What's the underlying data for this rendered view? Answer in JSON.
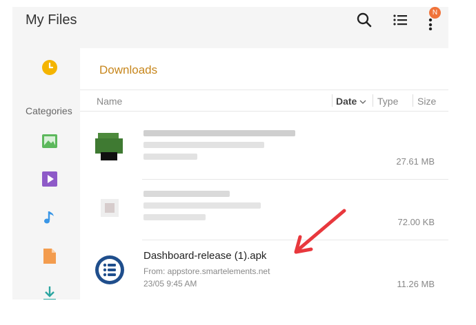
{
  "app": {
    "title": "My Files"
  },
  "header": {
    "notification_badge": "N",
    "accent_color": "#f0733a"
  },
  "sidebar": {
    "categories_label": "Categories",
    "items": [
      {
        "icon": "recent-clock-icon",
        "color": "#f4b400"
      },
      {
        "icon": "image-icon",
        "color": "#5cb85c"
      },
      {
        "icon": "video-icon",
        "color": "#8e5ac8"
      },
      {
        "icon": "music-note-icon",
        "color": "#3a96e6"
      },
      {
        "icon": "document-icon",
        "color": "#f39c4e"
      },
      {
        "icon": "download-icon",
        "color": "#2aa5a0"
      }
    ]
  },
  "main": {
    "folder_title": "Downloads",
    "columns": {
      "name": "Name",
      "date": "Date",
      "type": "Type",
      "size": "Size"
    },
    "files": [
      {
        "name": "",
        "source": "",
        "date": "",
        "size": "27.61 MB",
        "blurred": true
      },
      {
        "name": "",
        "source": "",
        "date": "",
        "size": "72.00 KB",
        "blurred": true
      },
      {
        "name": "Dashboard-release (1).apk",
        "source": "From: appstore.smartelements.net",
        "date": "23/05 9:45 AM",
        "size": "11.26 MB",
        "blurred": false
      }
    ]
  },
  "annotation": {
    "arrow_color": "#e8383d"
  }
}
